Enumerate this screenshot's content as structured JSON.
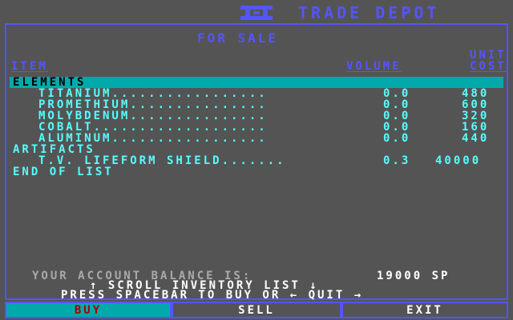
{
  "header": {
    "title": "TRADE DEPOT",
    "logo_icon": "interstel-logo-icon"
  },
  "panel": {
    "heading": "FOR SALE",
    "col_item": "ITEM",
    "col_volume": "VOLUME",
    "col_unit": "UNIT",
    "col_cost": "COST"
  },
  "inventory": [
    {
      "kind": "category",
      "label": "ELEMENTS"
    },
    {
      "kind": "item",
      "name": "TITANIUM",
      "leader": "TITANIUM.................",
      "volume": "0.0",
      "cost": "480"
    },
    {
      "kind": "item",
      "name": "PROMETHIUM",
      "leader": "PROMETHIUM...............",
      "volume": "0.0",
      "cost": "600"
    },
    {
      "kind": "item",
      "name": "MOLYBDENUM",
      "leader": "MOLYBDENUM...............",
      "volume": "0.0",
      "cost": "320"
    },
    {
      "kind": "item",
      "name": "COBALT",
      "leader": "COBALT...................",
      "volume": "0.0",
      "cost": "160"
    },
    {
      "kind": "item",
      "name": "ALUMINUM",
      "leader": "ALUMINUM.................",
      "volume": "0.0",
      "cost": "440"
    },
    {
      "kind": "category",
      "label": "ARTIFACTS"
    },
    {
      "kind": "item",
      "name": "T.V. LIFEFORM SHIELD",
      "leader": "T.V. LIFEFORM SHIELD.......",
      "volume": "0.3",
      "cost": "40000"
    },
    {
      "kind": "end",
      "label": "END OF LIST"
    }
  ],
  "footer": {
    "balance_label": "YOUR ACCOUNT BALANCE IS:",
    "balance_value": "19000 SP",
    "scroll_hint": "↑ SCROLL INVENTORY LIST ↓",
    "action_hint": "PRESS SPACEBAR TO BUY OR ← QUIT →"
  },
  "menu": {
    "buy": "BUY",
    "sell": "SELL",
    "exit": "EXIT",
    "selected": "BUY"
  },
  "colors": {
    "background": "#545454",
    "blue": "#5555ff",
    "cyan": "#55ffff",
    "highlight": "#00aaaa",
    "selected_text": "#aa0000"
  }
}
